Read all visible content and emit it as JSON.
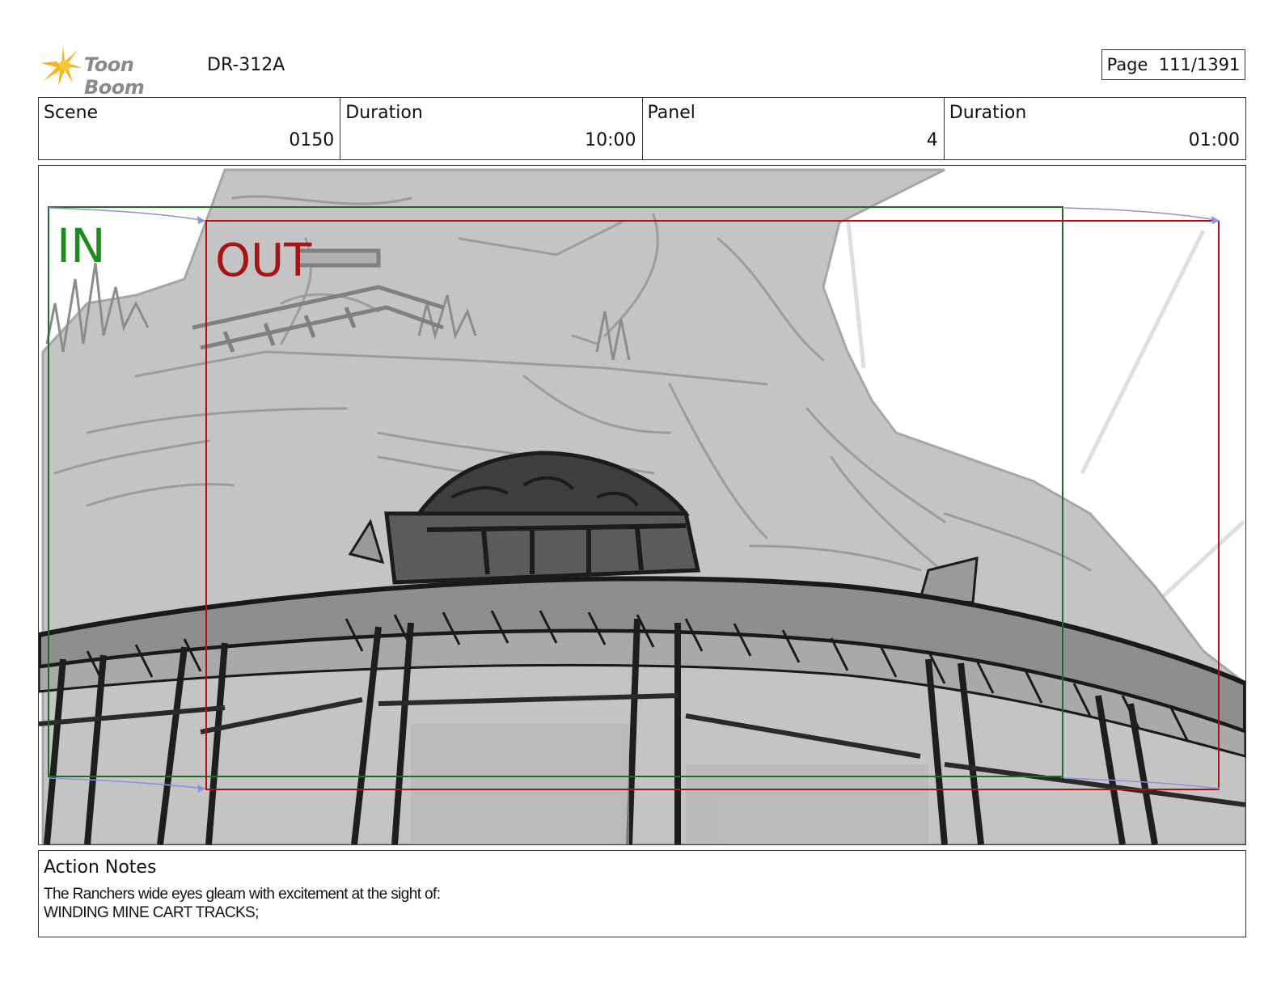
{
  "header": {
    "logo_text": "Toon Boom",
    "production_code": "DR-312A",
    "page_label": "Page",
    "page_value": "111/1391"
  },
  "info": [
    {
      "label": "Scene",
      "value": "0150"
    },
    {
      "label": "Duration",
      "value": "10:00"
    },
    {
      "label": "Panel",
      "value": "4"
    },
    {
      "label": "Duration",
      "value": "01:00"
    }
  ],
  "panel": {
    "in_label": "IN",
    "out_label": "OUT",
    "in_color": "#1f8a1f",
    "out_color": "#b01515"
  },
  "notes": {
    "title": "Action Notes",
    "body": "The Ranchers wide eyes gleam with excitement at the sight of:\nWINDING MINE CART TRACKS;"
  }
}
